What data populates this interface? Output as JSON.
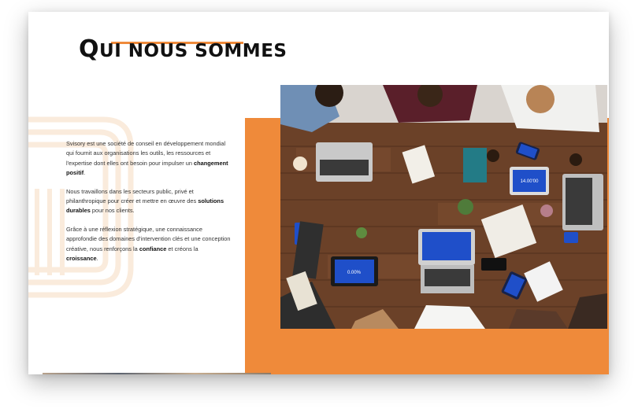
{
  "section": {
    "title_first_cap": "Q",
    "title_rest": "ui nous sommes"
  },
  "paragraphs": [
    {
      "before": "Svisory est une société de conseil en développement mondial qui fournit aux organisations les outils, les ressources et l'expertise dont elles ont besoin pour impulser un ",
      "bold1": "changement positif",
      "after": "."
    },
    {
      "before": "Nous travaillons dans les secteurs public, privé et philanthropique pour créer et mettre en œuvre des ",
      "bold1": "solutions durables",
      "after": " pour nos clients."
    },
    {
      "before": "Grâce à une réflexion stratégique, une connaissance approfondie des domaines d'intervention clés et une conception créative, nous renforçons la ",
      "bold1": "confiance",
      "middle": " et créons la ",
      "bold2": "croissance",
      "after": "."
    }
  ],
  "photo": {
    "tablet_readouts": [
      "14.00'00",
      "0.00%"
    ]
  },
  "colors": {
    "accent": "#ef8a3a",
    "table_wood": "#6b4128",
    "screen_blue": "#1f4fc9"
  }
}
